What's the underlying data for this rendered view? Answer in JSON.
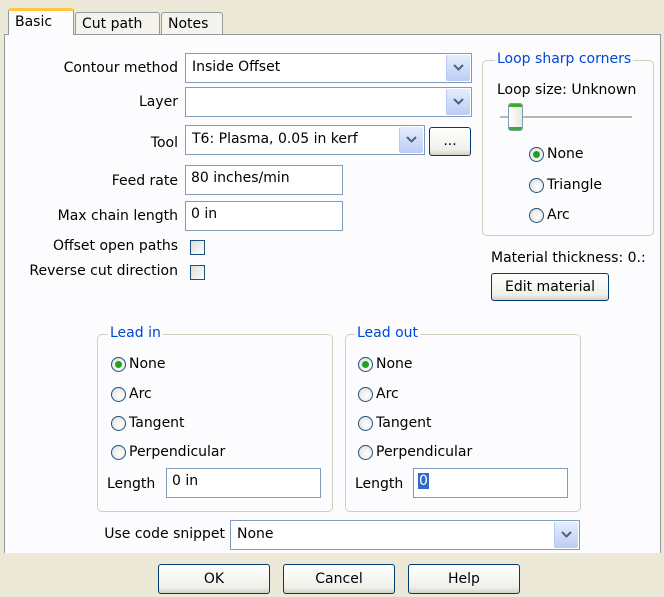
{
  "tabs": [
    {
      "label": "Basic"
    },
    {
      "label": "Cut path"
    },
    {
      "label": "Notes"
    }
  ],
  "form": {
    "contour_method": {
      "label": "Contour method",
      "value": "Inside Offset"
    },
    "layer": {
      "label": "Layer",
      "value": ""
    },
    "tool": {
      "label": "Tool",
      "value": "T6: Plasma, 0.05 in kerf",
      "browse_label": "..."
    },
    "feed_rate": {
      "label": "Feed rate",
      "value": "80 inches/min"
    },
    "max_chain_length": {
      "label": "Max chain length",
      "value": "0 in"
    },
    "offset_open_paths": {
      "label": "Offset open paths",
      "checked": false
    },
    "reverse_cut_direction": {
      "label": "Reverse cut direction",
      "checked": false
    }
  },
  "loop": {
    "title": "Loop sharp corners",
    "size_label": "Loop size: Unknown",
    "slider_level": 0,
    "options": [
      "None",
      "Triangle",
      "Arc"
    ],
    "selected": "None"
  },
  "material": {
    "thickness_label": "Material thickness: 0.:",
    "edit_button": "Edit material"
  },
  "lead_in": {
    "title": "Lead in",
    "options": [
      "None",
      "Arc",
      "Tangent",
      "Perpendicular"
    ],
    "selected": "None",
    "length_label": "Length",
    "length_value": "0 in"
  },
  "lead_out": {
    "title": "Lead out",
    "options": [
      "None",
      "Arc",
      "Tangent",
      "Perpendicular"
    ],
    "selected": "None",
    "length_label": "Length",
    "length_value": "0"
  },
  "snippet": {
    "label": "Use code snippet",
    "value": "None"
  },
  "buttons": {
    "ok": "OK",
    "cancel": "Cancel",
    "help": "Help"
  },
  "colors": {
    "group_title": "#0046D5",
    "tab_highlight": "#FFC83C",
    "radio_dot": "#21A121"
  }
}
